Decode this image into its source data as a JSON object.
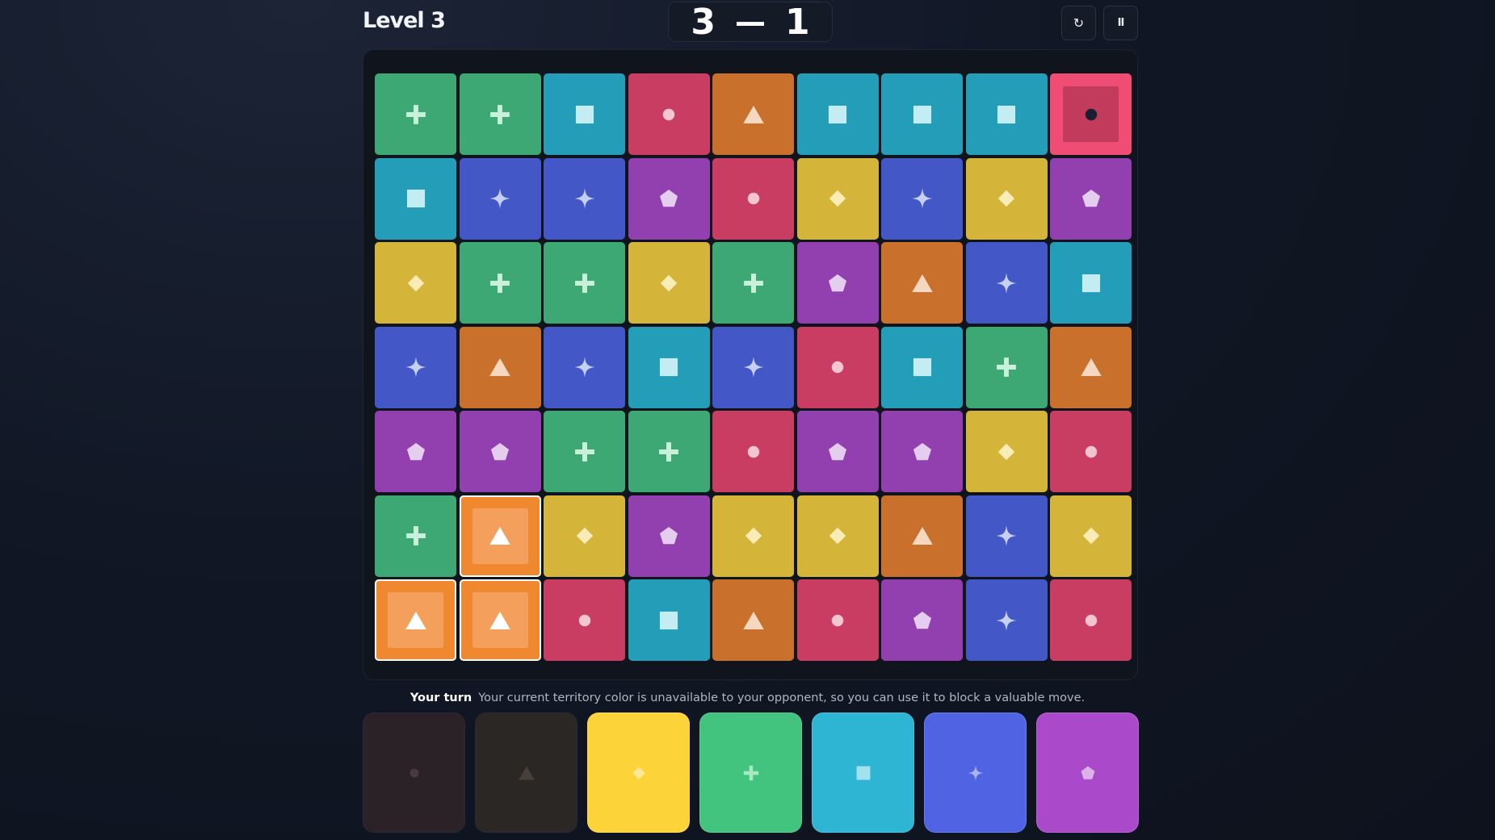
{
  "header": {
    "title": "Level 3"
  },
  "score": {
    "player": "3",
    "separator": "—",
    "opponent": "1"
  },
  "controls": {
    "restart_glyph": "↻",
    "pause_glyph": "II"
  },
  "colors": {
    "pink": {
      "bg": "#ca3d63",
      "fg": "#f5c6d2"
    },
    "orange": {
      "bg": "#c8702c",
      "fg": "#f6d8c0"
    },
    "yellow": {
      "bg": "#d4b53a",
      "fg": "#f9ecb6"
    },
    "green": {
      "bg": "#3ea874",
      "fg": "#c8f0da"
    },
    "teal": {
      "bg": "#249db8",
      "fg": "#c4ecf3"
    },
    "blue": {
      "bg": "#4457c7",
      "fg": "#c6cff6"
    },
    "purple": {
      "bg": "#923faf",
      "fg": "#e5cdf0"
    }
  },
  "territory": {
    "player_color": "orange",
    "player_bg": "#f08830",
    "player_inner": "#f4a05c",
    "player_fg": "#ffffff",
    "opponent_color": "pink",
    "opponent_bg": "#f04d74",
    "opponent_inner": "#c23a5c",
    "opponent_fg": "#1c1f33"
  },
  "icons": {
    "pink": "circle-icon",
    "orange": "triangle-icon",
    "yellow": "diamond-icon",
    "green": "plus-icon",
    "teal": "square-icon",
    "blue": "star-icon",
    "purple": "pentagon-icon"
  },
  "board": {
    "rows": [
      [
        "green",
        "green",
        "teal",
        "pink",
        "orange",
        "teal",
        "teal",
        "teal",
        "pink"
      ],
      [
        "teal",
        "blue",
        "blue",
        "purple",
        "pink",
        "yellow",
        "blue",
        "yellow",
        "purple"
      ],
      [
        "yellow",
        "green",
        "green",
        "yellow",
        "green",
        "purple",
        "orange",
        "blue",
        "teal"
      ],
      [
        "blue",
        "orange",
        "blue",
        "teal",
        "blue",
        "pink",
        "teal",
        "green",
        "orange"
      ],
      [
        "purple",
        "purple",
        "green",
        "green",
        "pink",
        "purple",
        "purple",
        "yellow",
        "pink"
      ],
      [
        "green",
        "orange",
        "yellow",
        "purple",
        "yellow",
        "yellow",
        "orange",
        "blue",
        "yellow"
      ],
      [
        "orange",
        "orange",
        "pink",
        "teal",
        "orange",
        "pink",
        "purple",
        "blue",
        "pink"
      ]
    ],
    "owner": [
      [
        "",
        "",
        "",
        "",
        "",
        "",
        "",
        "",
        "opp"
      ],
      [
        "",
        "",
        "",
        "",
        "",
        "",
        "",
        "",
        ""
      ],
      [
        "",
        "",
        "",
        "",
        "",
        "",
        "",
        "",
        ""
      ],
      [
        "",
        "",
        "",
        "",
        "",
        "",
        "",
        "",
        ""
      ],
      [
        "",
        "",
        "",
        "",
        "",
        "",
        "",
        "",
        ""
      ],
      [
        "",
        "mine",
        "",
        "",
        "",
        "",
        "",
        "",
        ""
      ],
      [
        "mine",
        "mine",
        "",
        "",
        "",
        "",
        "",
        "",
        ""
      ]
    ]
  },
  "status": {
    "turn_label": "Your turn",
    "message": "Your current territory color is unavailable to your opponent, so you can use it to block a valuable move."
  },
  "picker": [
    {
      "color": "pink",
      "bg": "#2a2227",
      "fg": "#4a3a40",
      "enabled": false
    },
    {
      "color": "orange",
      "bg": "#2b2724",
      "fg": "#47403a",
      "enabled": false
    },
    {
      "color": "yellow",
      "bg": "#fdd33a",
      "fg": "#fbe79a",
      "enabled": true
    },
    {
      "color": "green",
      "bg": "#42c47e",
      "fg": "#a7e9c4",
      "enabled": true
    },
    {
      "color": "teal",
      "bg": "#2db5d3",
      "fg": "#a2e2ef",
      "enabled": true
    },
    {
      "color": "blue",
      "bg": "#4f63e3",
      "fg": "#a9b6f4",
      "enabled": true
    },
    {
      "color": "purple",
      "bg": "#ab49cb",
      "fg": "#dcb2ea",
      "enabled": true
    }
  ]
}
